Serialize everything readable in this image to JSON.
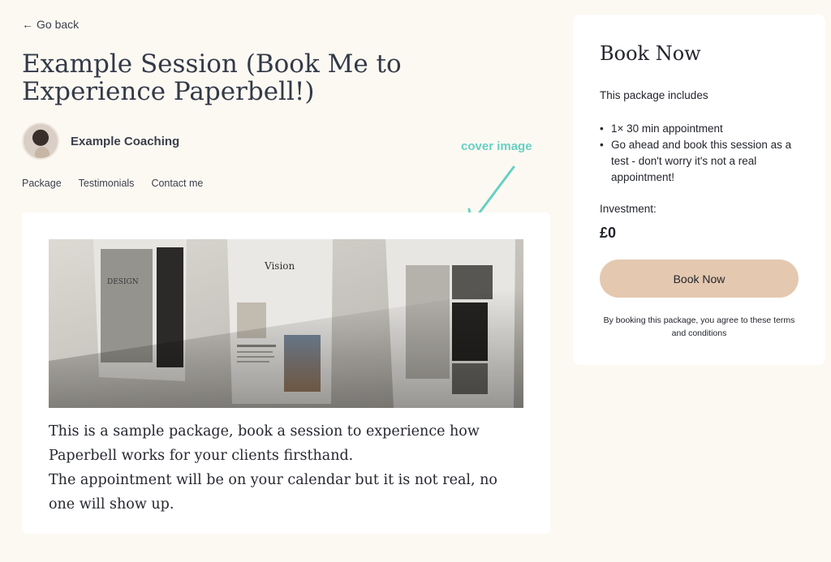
{
  "nav": {
    "back_arrow": "←",
    "back_label": "Go back"
  },
  "session": {
    "title": "Example Session (Book Me to Experience Paperbell!)"
  },
  "profile": {
    "name": "Example Coaching"
  },
  "tabs": [
    {
      "label": "Package"
    },
    {
      "label": "Testimonials"
    },
    {
      "label": "Contact me"
    }
  ],
  "annotation": {
    "label": "cover image",
    "color": "#67d0c3"
  },
  "cover": {
    "vision_text": "Vision",
    "design_text": "DESIGN"
  },
  "description": {
    "paragraphs": [
      "This is a sample package, book a session to experience how Paperbell works for your clients firsthand.",
      "The appointment will be on your calendar but it is not real, no one will show up."
    ]
  },
  "booking": {
    "title": "Book Now",
    "includes_label": "This package includes",
    "items": [
      "1× 30 min appointment",
      "Go ahead and book this session as a test - don't worry it's not a real appointment!"
    ],
    "investment_label": "Investment:",
    "price": "£0",
    "button_label": "Book Now",
    "terms": "By booking this package, you agree to these terms and conditions"
  },
  "colors": {
    "background": "#fcf9f3",
    "button": "#e4c8b0",
    "card": "#ffffff"
  }
}
